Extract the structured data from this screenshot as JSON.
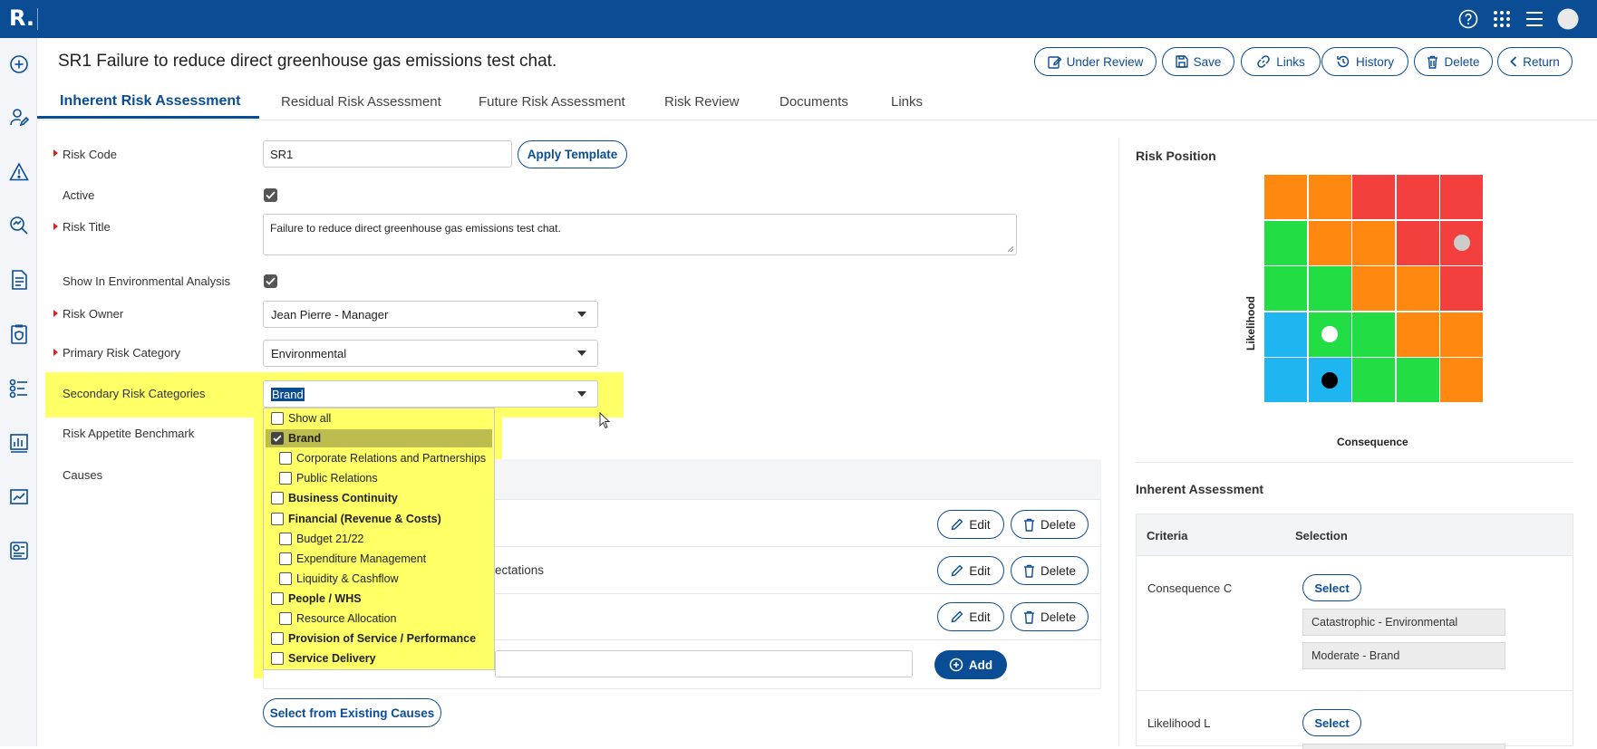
{
  "app": {
    "logo": "R."
  },
  "page": {
    "title": "SR1 Failure to reduce direct greenhouse gas emissions test chat."
  },
  "header_buttons": {
    "under_review": "Under Review",
    "save": "Save",
    "links": "Links",
    "history": "History",
    "delete": "Delete",
    "return": "Return"
  },
  "tabs": [
    "Inherent Risk Assessment",
    "Residual Risk Assessment",
    "Future Risk Assessment",
    "Risk Review",
    "Documents",
    "Links"
  ],
  "form": {
    "risk_code": {
      "label": "Risk Code",
      "value": "SR1"
    },
    "apply_template": "Apply Template",
    "active": {
      "label": "Active",
      "checked": true
    },
    "risk_title": {
      "label": "Risk Title",
      "value": "Failure to reduce direct greenhouse gas emissions test chat."
    },
    "show_env": {
      "label": "Show In Environmental Analysis",
      "checked": true
    },
    "risk_owner": {
      "label": "Risk Owner",
      "value": "Jean Pierre - Manager"
    },
    "primary_category": {
      "label": "Primary Risk Category",
      "value": "Environmental"
    },
    "secondary_categories": {
      "label": "Secondary Risk Categories",
      "value": "Brand"
    },
    "appetite": {
      "label": "Risk Appetite Benchmark"
    },
    "causes": {
      "label": "Causes"
    }
  },
  "dropdown": {
    "items": [
      {
        "label": "Show all",
        "level": 0,
        "bold": false,
        "checked": false
      },
      {
        "label": "Brand",
        "level": 0,
        "bold": true,
        "checked": true
      },
      {
        "label": "Corporate Relations and Partnerships",
        "level": 1,
        "bold": false,
        "checked": false
      },
      {
        "label": "Public Relations",
        "level": 1,
        "bold": false,
        "checked": false
      },
      {
        "label": "Business Continuity",
        "level": 0,
        "bold": true,
        "checked": false
      },
      {
        "label": "Financial (Revenue & Costs)",
        "level": 0,
        "bold": true,
        "checked": false
      },
      {
        "label": "Budget 21/22",
        "level": 1,
        "bold": false,
        "checked": false
      },
      {
        "label": "Expenditure Management",
        "level": 1,
        "bold": false,
        "checked": false
      },
      {
        "label": "Liquidity & Cashflow",
        "level": 1,
        "bold": false,
        "checked": false
      },
      {
        "label": "People / WHS",
        "level": 0,
        "bold": true,
        "checked": false
      },
      {
        "label": "Resource Allocation",
        "level": 1,
        "bold": false,
        "checked": false
      },
      {
        "label": "Provision of Service / Performance",
        "level": 0,
        "bold": true,
        "checked": false
      },
      {
        "label": "Service Delivery",
        "level": 0,
        "bold": true,
        "checked": false
      }
    ]
  },
  "causes_panel": {
    "row2_fragment": "ectations",
    "edit": "Edit",
    "delete": "Delete",
    "add": "Add",
    "select_existing": "Select from Existing Causes"
  },
  "risk_position": {
    "title": "Risk Position",
    "y_label": "Likelihood",
    "x_label": "Consequence",
    "colors": {
      "blue": "#1eb5f0",
      "green": "#22dd44",
      "orange": "#ff8811",
      "red": "#f43f3f"
    },
    "matrix": [
      [
        "orange",
        "orange",
        "red",
        "red",
        "red"
      ],
      [
        "green",
        "orange",
        "orange",
        "red",
        "red"
      ],
      [
        "green",
        "green",
        "orange",
        "orange",
        "red"
      ],
      [
        "blue",
        "green",
        "green",
        "orange",
        "orange"
      ],
      [
        "blue",
        "blue",
        "green",
        "green",
        "orange"
      ]
    ],
    "markers": [
      {
        "row": 2,
        "col": 5,
        "color": "#cccccc"
      },
      {
        "row": 4,
        "col": 2,
        "color": "#ffffff"
      },
      {
        "row": 5,
        "col": 2,
        "color": "#000000"
      }
    ]
  },
  "inherent": {
    "title": "Inherent Assessment",
    "col_criteria": "Criteria",
    "col_selection": "Selection",
    "consequence": {
      "label": "Consequence C",
      "select": "Select",
      "values": [
        "Catastrophic - Environmental",
        "Moderate - Brand"
      ]
    },
    "likelihood": {
      "label": "Likelihood L",
      "select": "Select"
    }
  }
}
